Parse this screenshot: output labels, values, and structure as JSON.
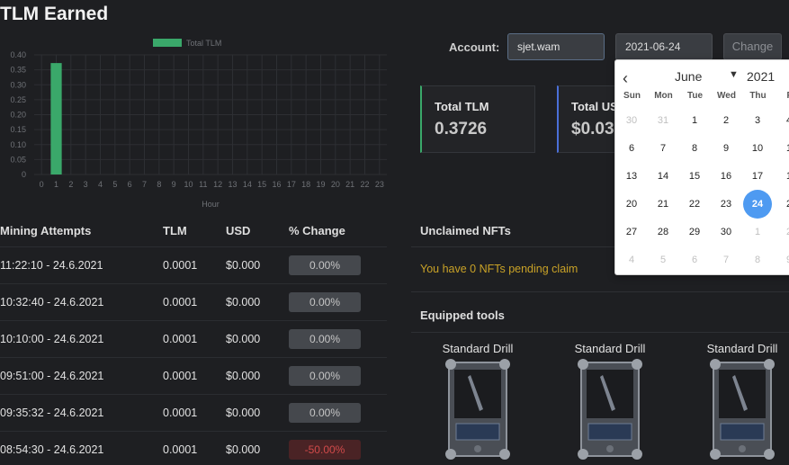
{
  "page": {
    "title": "TLM Earned"
  },
  "account": {
    "label": "Account:",
    "value": "sjet.wam",
    "date": "2021-06-24",
    "change_label": "Change"
  },
  "stats": [
    {
      "label": "Total TLM",
      "value": "0.3726"
    },
    {
      "label": "Total US",
      "value": "$0.03"
    }
  ],
  "chart_data": {
    "type": "bar",
    "legend": "Total TLM",
    "xlabel": "Hour",
    "ylabel": "",
    "categories": [
      "0",
      "1",
      "2",
      "3",
      "4",
      "5",
      "6",
      "7",
      "8",
      "9",
      "10",
      "11",
      "12",
      "13",
      "14",
      "15",
      "16",
      "17",
      "18",
      "19",
      "20",
      "21",
      "22",
      "23"
    ],
    "values": [
      0,
      0.3726,
      0,
      0,
      0,
      0,
      0,
      0,
      0,
      0,
      0,
      0,
      0,
      0,
      0,
      0,
      0,
      0,
      0,
      0,
      0,
      0,
      0,
      0
    ],
    "y_ticks": [
      "0",
      "0.05",
      "0.10",
      "0.15",
      "0.20",
      "0.25",
      "0.30",
      "0.35",
      "0.40"
    ],
    "ylim": [
      0,
      0.4
    ],
    "grid": true,
    "colors": {
      "bar": "#3aa86a",
      "grid": "#2d2f33",
      "text": "#6f7277"
    }
  },
  "table": {
    "headers": [
      "Mining Attempts",
      "TLM",
      "USD",
      "% Change"
    ],
    "rows": [
      {
        "time": "11:22:10 - 24.6.2021",
        "tlm": "0.0001",
        "usd": "$0.000",
        "change": "0.00%"
      },
      {
        "time": "10:32:40 - 24.6.2021",
        "tlm": "0.0001",
        "usd": "$0.000",
        "change": "0.00%"
      },
      {
        "time": "10:10:00 - 24.6.2021",
        "tlm": "0.0001",
        "usd": "$0.000",
        "change": "0.00%"
      },
      {
        "time": "09:51:00 - 24.6.2021",
        "tlm": "0.0001",
        "usd": "$0.000",
        "change": "0.00%"
      },
      {
        "time": "09:35:32 - 24.6.2021",
        "tlm": "0.0001",
        "usd": "$0.000",
        "change": "0.00%"
      },
      {
        "time": "08:54:30 - 24.6.2021",
        "tlm": "0.0001",
        "usd": "$0.000",
        "change": "-50.00%"
      }
    ]
  },
  "nfts": {
    "title": "Unclaimed NFTs",
    "message": "You have 0 NFTs pending claim"
  },
  "tools": {
    "title": "Equipped tools",
    "items": [
      {
        "name": "Standard Drill"
      },
      {
        "name": "Standard Drill"
      },
      {
        "name": "Standard Drill"
      }
    ]
  },
  "datepicker": {
    "month": "June",
    "year": "2021",
    "weekdays": [
      "Sun",
      "Mon",
      "Tue",
      "Wed",
      "Thu",
      "F"
    ],
    "weeks": [
      [
        "30",
        "31",
        "1",
        "2",
        "3",
        "4"
      ],
      [
        "6",
        "7",
        "8",
        "9",
        "10",
        "1"
      ],
      [
        "13",
        "14",
        "15",
        "16",
        "17",
        "1"
      ],
      [
        "20",
        "21",
        "22",
        "23",
        "24",
        "2"
      ],
      [
        "27",
        "28",
        "29",
        "30",
        "1",
        "2"
      ],
      [
        "4",
        "5",
        "6",
        "7",
        "8",
        "9"
      ]
    ],
    "selected": "24"
  }
}
